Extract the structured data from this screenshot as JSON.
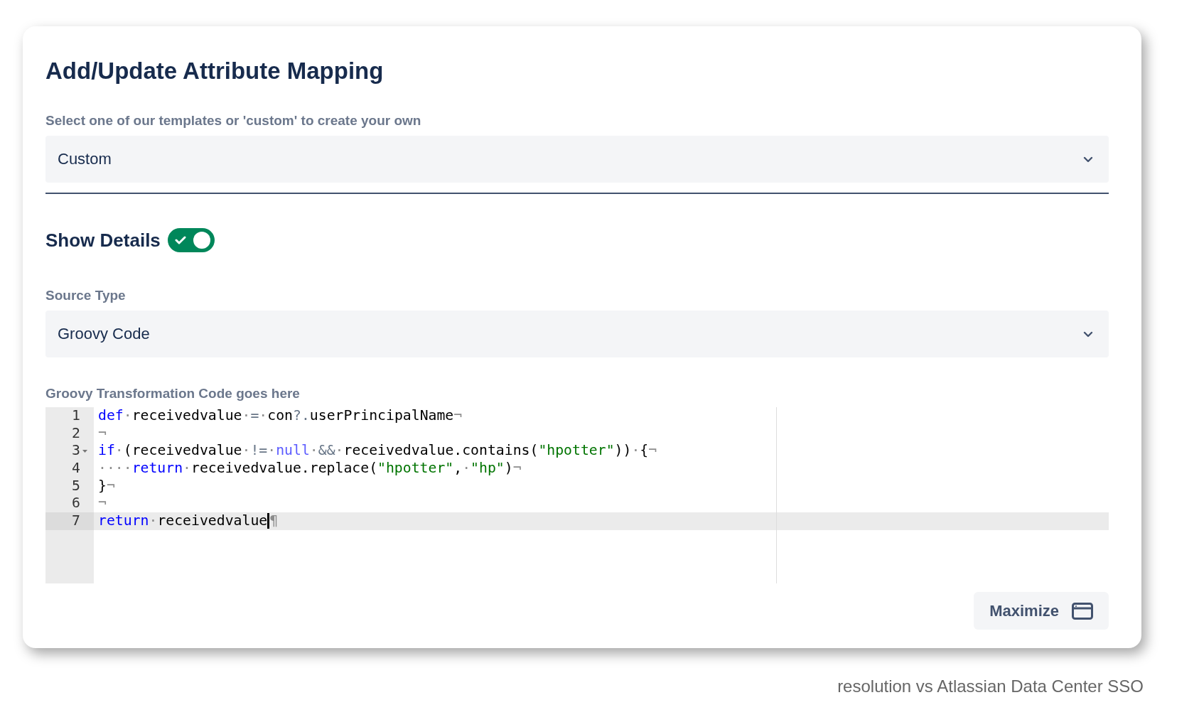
{
  "dialog": {
    "title": "Add/Update Attribute Mapping",
    "template": {
      "label": "Select one of our templates or 'custom' to create your own",
      "value": "Custom"
    },
    "show_details": {
      "label": "Show Details",
      "on": true
    },
    "source_type": {
      "label": "Source Type",
      "value": "Groovy Code"
    },
    "code_editor": {
      "label": "Groovy Transformation Code goes here",
      "lines": [
        {
          "number": "1",
          "foldable": false,
          "active": false,
          "tokens": [
            {
              "kind": "keyword",
              "text": "def"
            },
            {
              "kind": "invisible",
              "text": "·"
            },
            {
              "kind": "plain",
              "text": "receivedvalue"
            },
            {
              "kind": "invisible",
              "text": "·"
            },
            {
              "kind": "operator",
              "text": "="
            },
            {
              "kind": "invisible",
              "text": "·"
            },
            {
              "kind": "plain",
              "text": "con"
            },
            {
              "kind": "operator",
              "text": "?."
            },
            {
              "kind": "plain",
              "text": "userPrincipalName"
            },
            {
              "kind": "invisible",
              "text": "¬"
            }
          ]
        },
        {
          "number": "2",
          "foldable": false,
          "active": false,
          "tokens": [
            {
              "kind": "invisible",
              "text": "¬"
            }
          ]
        },
        {
          "number": "3",
          "foldable": true,
          "active": false,
          "tokens": [
            {
              "kind": "keyword",
              "text": "if"
            },
            {
              "kind": "invisible",
              "text": "·"
            },
            {
              "kind": "plain",
              "text": "(receivedvalue"
            },
            {
              "kind": "invisible",
              "text": "·"
            },
            {
              "kind": "operator",
              "text": "!="
            },
            {
              "kind": "invisible",
              "text": "·"
            },
            {
              "kind": "constant",
              "text": "null"
            },
            {
              "kind": "invisible",
              "text": "·"
            },
            {
              "kind": "operator",
              "text": "&&"
            },
            {
              "kind": "invisible",
              "text": "·"
            },
            {
              "kind": "plain",
              "text": "receivedvalue.contains("
            },
            {
              "kind": "string",
              "text": "\"hpotter\""
            },
            {
              "kind": "plain",
              "text": "))"
            },
            {
              "kind": "invisible",
              "text": "·"
            },
            {
              "kind": "plain",
              "text": "{"
            },
            {
              "kind": "invisible",
              "text": "¬"
            }
          ]
        },
        {
          "number": "4",
          "foldable": false,
          "active": false,
          "tokens": [
            {
              "kind": "invisible",
              "text": "····"
            },
            {
              "kind": "keyword",
              "text": "return"
            },
            {
              "kind": "invisible",
              "text": "·"
            },
            {
              "kind": "plain",
              "text": "receivedvalue.replace("
            },
            {
              "kind": "string",
              "text": "\"hpotter\""
            },
            {
              "kind": "plain",
              "text": ","
            },
            {
              "kind": "invisible",
              "text": "·"
            },
            {
              "kind": "string",
              "text": "\"hp\""
            },
            {
              "kind": "plain",
              "text": ")"
            },
            {
              "kind": "invisible",
              "text": "¬"
            }
          ]
        },
        {
          "number": "5",
          "foldable": false,
          "active": false,
          "tokens": [
            {
              "kind": "plain",
              "text": "}"
            },
            {
              "kind": "invisible",
              "text": "¬"
            }
          ]
        },
        {
          "number": "6",
          "foldable": false,
          "active": false,
          "tokens": [
            {
              "kind": "invisible",
              "text": "¬"
            }
          ]
        },
        {
          "number": "7",
          "foldable": false,
          "active": true,
          "tokens": [
            {
              "kind": "keyword",
              "text": "return"
            },
            {
              "kind": "invisible",
              "text": "·"
            },
            {
              "kind": "plain",
              "text": "receivedvalue"
            },
            {
              "kind": "cursor"
            },
            {
              "kind": "invisible",
              "text": "¶"
            }
          ]
        }
      ]
    },
    "maximize_button": {
      "label": "Maximize"
    }
  },
  "caption": "resolution vs Atlassian Data Center SSO"
}
